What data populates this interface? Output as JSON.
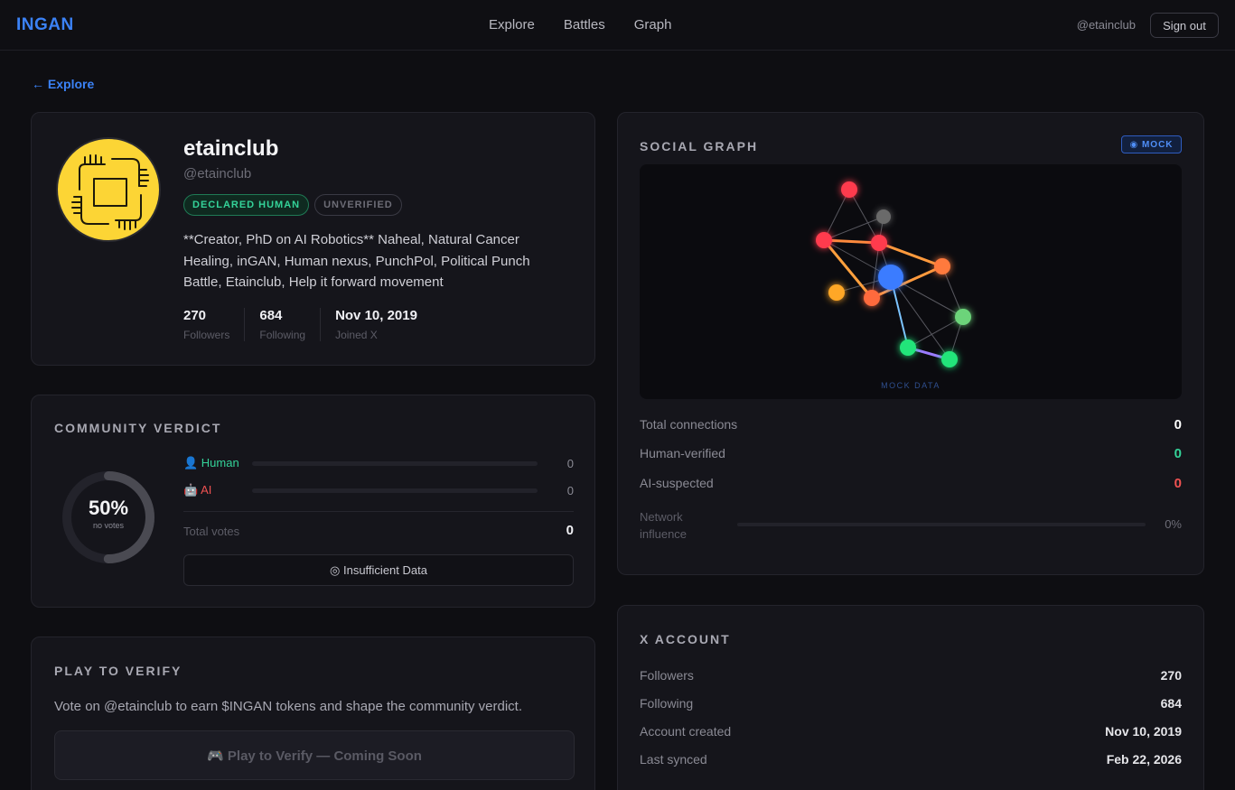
{
  "app": {
    "logo": "INGAN"
  },
  "nav": {
    "items": [
      "Explore",
      "Battles",
      "Graph"
    ]
  },
  "user_menu": {
    "handle": "@etainclub",
    "sign_out": "Sign out"
  },
  "back_link": "← Explore",
  "profile": {
    "name": "etainclub",
    "handle": "@etainclub",
    "badges": {
      "declared": "DECLARED HUMAN",
      "verified": "UNVERIFIED"
    },
    "bio": "**Creator, PhD on AI Robotics** Naheal, Natural Cancer Healing, inGAN, Human nexus, PunchPol, Political Punch Battle, Etainclub, Help it forward movement",
    "stats": [
      {
        "value": "270",
        "label": "Followers"
      },
      {
        "value": "684",
        "label": "Following"
      },
      {
        "value": "Nov 10, 2019",
        "label": "Joined X"
      }
    ]
  },
  "verdict": {
    "title": "COMMUNITY VERDICT",
    "percent": "50%",
    "percent_value": 0.5,
    "subtitle": "no votes",
    "human_label": "👤 Human",
    "human_count": "0",
    "ai_label": "🤖 AI",
    "ai_count": "0",
    "total_label": "Total votes",
    "total_value": "0",
    "status": "◎ Insufficient Data"
  },
  "play": {
    "title": "PLAY TO VERIFY",
    "description": "Vote on @etainclub to earn $INGAN tokens and shape the community verdict.",
    "button": "🎮 Play to Verify — Coming Soon"
  },
  "graph": {
    "title": "SOCIAL GRAPH",
    "mock_badge": "◉ MOCK",
    "mock_label": "MOCK DATA",
    "stats": [
      {
        "label": "Total connections",
        "value": "0",
        "color": "#ffffff"
      },
      {
        "label": "Human-verified",
        "value": "0",
        "color": "#34d399"
      },
      {
        "label": "AI-suspected",
        "value": "0",
        "color": "#f05252"
      }
    ],
    "influence_label": "Network influence",
    "influence_value": "0%"
  },
  "x_account": {
    "title": "X ACCOUNT",
    "rows": [
      {
        "label": "Followers",
        "value": "270"
      },
      {
        "label": "Following",
        "value": "684"
      },
      {
        "label": "Account created",
        "value": "Nov 10, 2019"
      },
      {
        "label": "Last synced",
        "value": "Feb 22, 2026"
      }
    ]
  },
  "colors": {
    "accent": "#3b82f6",
    "human": "#34d399",
    "ai": "#f05252",
    "node_red": "#ff3b4e",
    "node_orange": "#ff7a3d",
    "node_amber": "#ffa726",
    "node_blue": "#3b7bff",
    "node_green": "#22e57a",
    "node_gray": "#6b6b6b"
  }
}
